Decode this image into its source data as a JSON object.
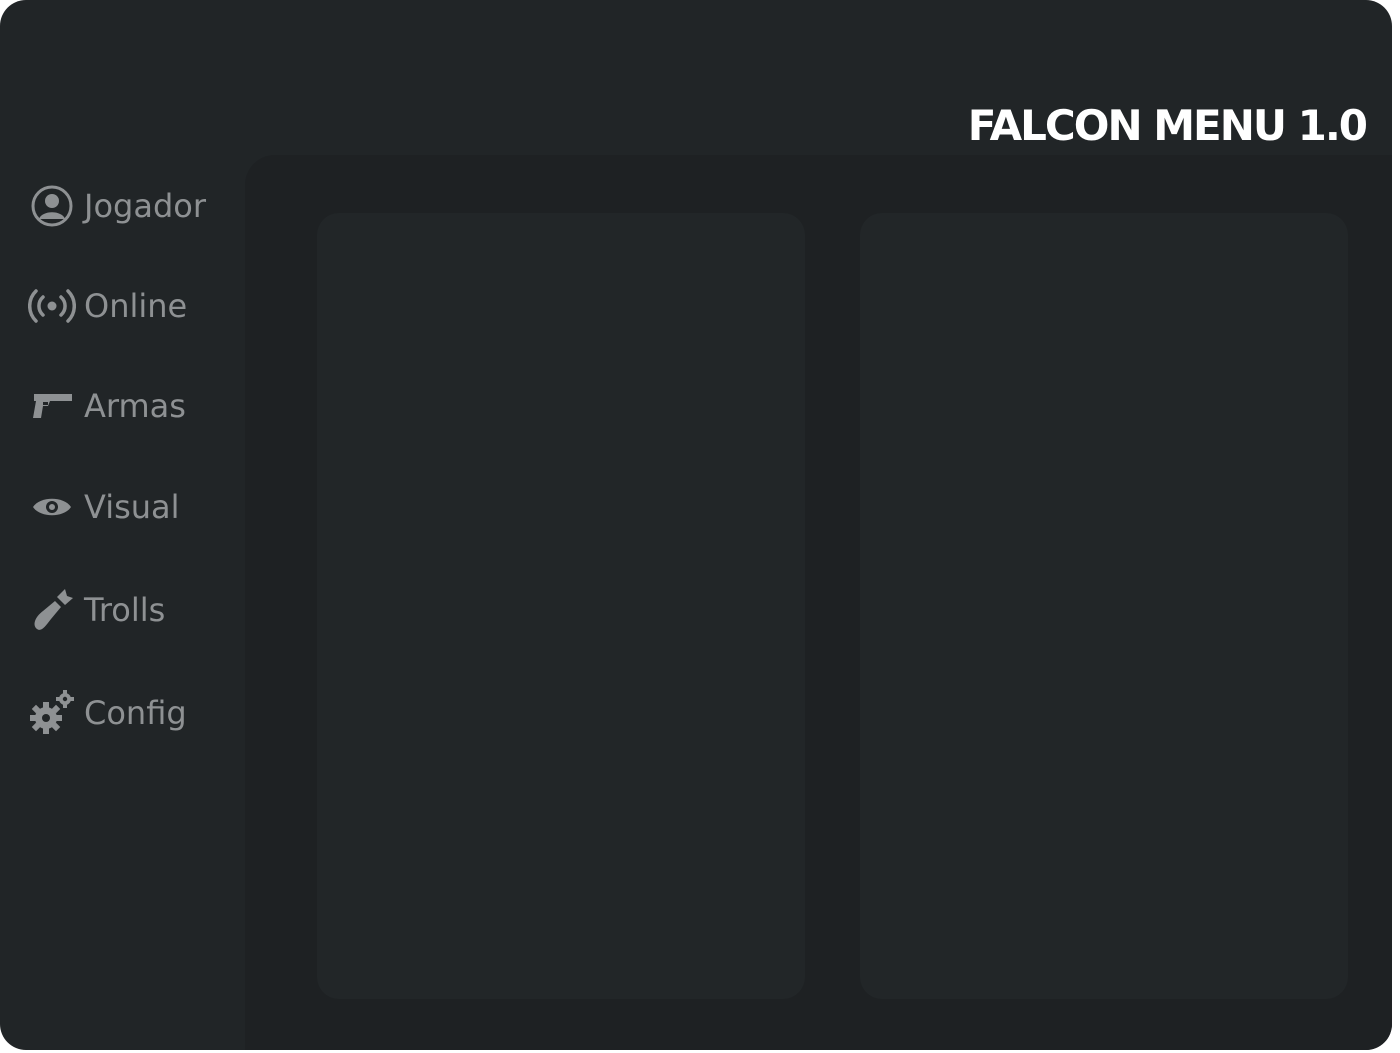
{
  "app": {
    "title": "FALCON MENU 1.0"
  },
  "colors": {
    "window_bg": "#212527",
    "content_bg": "#1e2123",
    "panel_bg": "#222628",
    "nav_text": "#8e9193",
    "title_text": "#ffffff"
  },
  "sidebar": {
    "items": [
      {
        "label": "Jogador",
        "icon": "user-circle-icon"
      },
      {
        "label": "Online",
        "icon": "broadcast-icon"
      },
      {
        "label": "Armas",
        "icon": "pistol-icon"
      },
      {
        "label": "Visual",
        "icon": "eye-icon"
      },
      {
        "label": "Trolls",
        "icon": "bomb-icon"
      },
      {
        "label": "Config",
        "icon": "gears-icon"
      }
    ]
  }
}
